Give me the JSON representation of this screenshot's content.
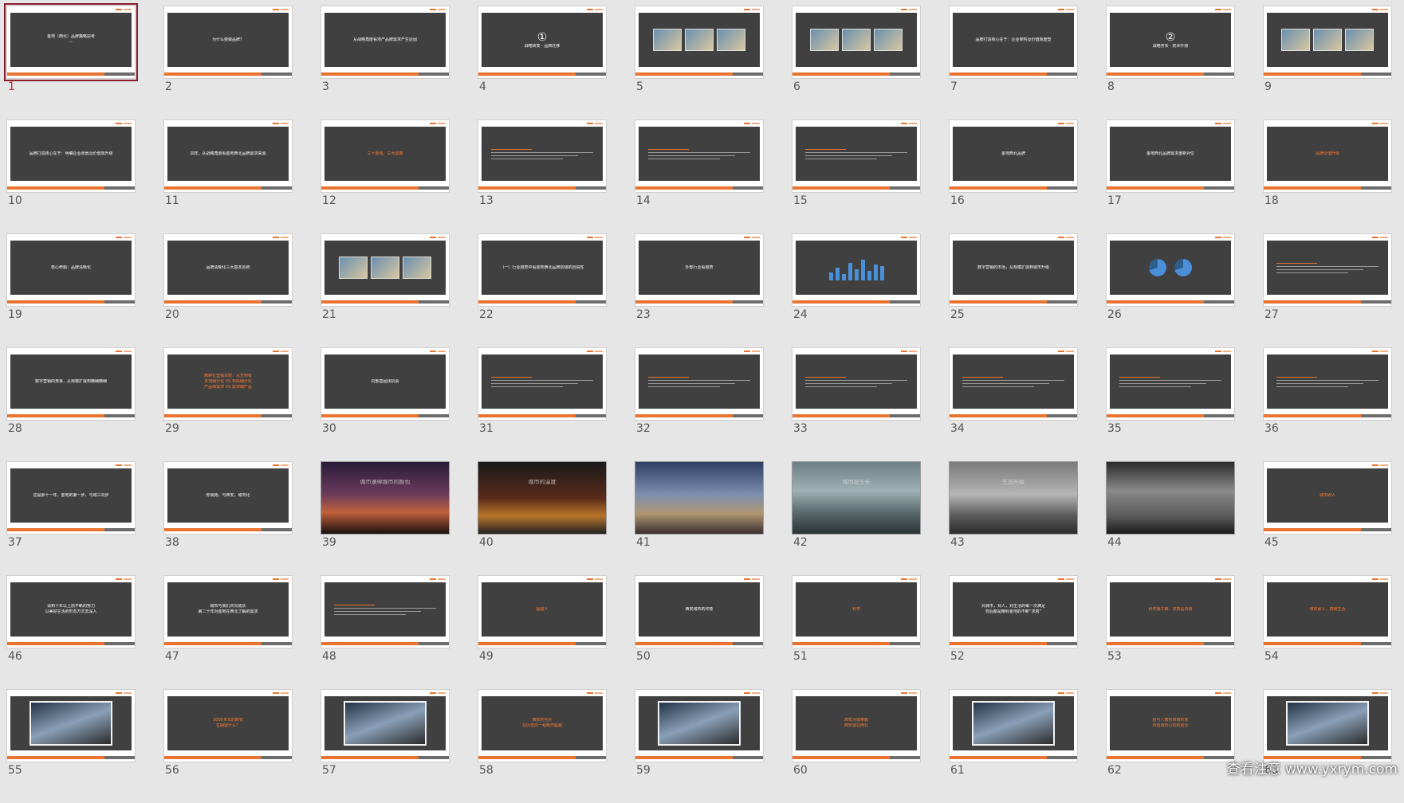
{
  "selected": 1,
  "watermark": "查看注意 www.yxrym.com",
  "slides": [
    {
      "n": "1",
      "kind": "title",
      "lines": [
        "金地（西北）品牌策略思考",
        "····"
      ]
    },
    {
      "n": "2",
      "kind": "text",
      "lines": [
        "为什么要做品牌？"
      ]
    },
    {
      "n": "3",
      "kind": "text",
      "lines": [
        "从战略角度看地产品牌需求产生原因"
      ]
    },
    {
      "n": "4",
      "kind": "circle",
      "circle": "①",
      "lines": [
        "战略转变 · 品牌迁移"
      ]
    },
    {
      "n": "5",
      "kind": "images",
      "lines": []
    },
    {
      "n": "6",
      "kind": "images",
      "lines": []
    },
    {
      "n": "7",
      "kind": "text",
      "lines": [
        "品牌打造核心在于：企业架构及价值观重塑"
      ]
    },
    {
      "n": "8",
      "kind": "circle",
      "circle": "②",
      "lines": [
        "战略务实 · 技术升级"
      ]
    },
    {
      "n": "9",
      "kind": "images",
      "lines": []
    },
    {
      "n": "10",
      "kind": "text",
      "lines": [
        "品牌打造核心在于：明确企业愿景及价值观升级"
      ]
    },
    {
      "n": "11",
      "kind": "text",
      "lines": [
        "同样，从战略角度看金地西北品牌需求来源"
      ]
    },
    {
      "n": "12",
      "kind": "orange",
      "lines": [
        "三十金城，三大需要"
      ]
    },
    {
      "n": "13",
      "kind": "lines",
      "lines": []
    },
    {
      "n": "14",
      "kind": "lines",
      "lines": []
    },
    {
      "n": "15",
      "kind": "lines",
      "lines": []
    },
    {
      "n": "16",
      "kind": "text",
      "lines": [
        "金地西北品牌"
      ]
    },
    {
      "n": "17",
      "kind": "text",
      "lines": [
        "金地西北品牌需求重新对位"
      ]
    },
    {
      "n": "18",
      "kind": "orange",
      "lines": [
        "品牌价值升级"
      ]
    },
    {
      "n": "19",
      "kind": "text",
      "lines": [
        "核心命题：品牌清晰化"
      ]
    },
    {
      "n": "20",
      "kind": "text",
      "lines": [
        "品牌清晰化三大基本原则"
      ]
    },
    {
      "n": "21",
      "kind": "images",
      "lines": []
    },
    {
      "n": "22",
      "kind": "text",
      "lines": [
        "（一）行业趋势中看金地西北品牌层级的自由性"
      ]
    },
    {
      "n": "23",
      "kind": "text",
      "lines": [
        "外部行业看趋势"
      ]
    },
    {
      "n": "24",
      "kind": "chart",
      "lines": []
    },
    {
      "n": "25",
      "kind": "text",
      "lines": [
        "数字营销的市场，从规模扩展到城市升级"
      ]
    },
    {
      "n": "26",
      "kind": "pies",
      "lines": []
    },
    {
      "n": "27",
      "kind": "lines",
      "lines": []
    },
    {
      "n": "28",
      "kind": "text",
      "lines": [
        "数字营销的竞争，从规模扩展到精细精细"
      ]
    },
    {
      "n": "29",
      "kind": "orange",
      "lines": [
        "精耕化营销本质：从无到有",
        "多地细分化 VS 布局细分化",
        "产品细需求 VS 需求细产品"
      ]
    },
    {
      "n": "30",
      "kind": "text",
      "lines": [
        "内部基因找机会"
      ]
    },
    {
      "n": "31",
      "kind": "lines",
      "lines": []
    },
    {
      "n": "32",
      "kind": "lines",
      "lines": []
    },
    {
      "n": "33",
      "kind": "lines",
      "lines": []
    },
    {
      "n": "34",
      "kind": "lines",
      "lines": []
    },
    {
      "n": "35",
      "kind": "lines",
      "lines": []
    },
    {
      "n": "36",
      "kind": "lines",
      "lines": []
    },
    {
      "n": "37",
      "kind": "text",
      "lines": [
        "这是那十一年，金地的第一步，与城三同步"
      ]
    },
    {
      "n": "38",
      "kind": "text",
      "lines": [
        "你我她，与西安，城市化"
      ]
    },
    {
      "n": "39",
      "kind": "photo",
      "style": "city1",
      "lines": [
        "城市速得城市的颜色"
      ]
    },
    {
      "n": "40",
      "kind": "photo",
      "style": "city2",
      "lines": [
        "城市的温度"
      ]
    },
    {
      "n": "41",
      "kind": "photo",
      "style": "city3",
      "lines": [
        ""
      ]
    },
    {
      "n": "42",
      "kind": "photo",
      "style": "city4",
      "lines": [
        "城市在生长"
      ]
    },
    {
      "n": "43",
      "kind": "photo",
      "style": "city5",
      "lines": [
        "生态升级"
      ]
    },
    {
      "n": "44",
      "kind": "photo",
      "style": "city6",
      "lines": [
        ""
      ]
    },
    {
      "n": "45",
      "kind": "orange",
      "lines": [
        "城市即人"
      ]
    },
    {
      "n": "46",
      "kind": "text",
      "lines": [
        "请到十年以上前不断的努力",
        "以美好生活的形态方式去深入"
      ]
    },
    {
      "n": "47",
      "kind": "text",
      "lines": [
        "城市与我们共同成长",
        "第二十年对金地在西北了解的需求"
      ]
    },
    {
      "n": "48",
      "kind": "lines",
      "lines": []
    },
    {
      "n": "49",
      "kind": "orange",
      "lines": [
        "超越人"
      ]
    },
    {
      "n": "50",
      "kind": "text",
      "lines": [
        "西安城市的印象"
      ]
    },
    {
      "n": "51",
      "kind": "orange",
      "lines": [
        "科学"
      ]
    },
    {
      "n": "52",
      "kind": "text",
      "lines": [
        "对城市，对人，对生活的每一次满足",
        "背后都是精科金地的不断“求真”"
      ]
    },
    {
      "n": "53",
      "kind": "orange",
      "lines": [
        "科学施工精，求真是内核"
      ]
    },
    {
      "n": "54",
      "kind": "orange",
      "lines": [
        "城市即人，真致生活"
      ]
    },
    {
      "n": "55",
      "kind": "framed",
      "lines": []
    },
    {
      "n": "56",
      "kind": "orange",
      "lines": [
        "3000多年的西安",
        "在期望什么？"
      ]
    },
    {
      "n": "57",
      "kind": "framed",
      "lines": []
    },
    {
      "n": "58",
      "kind": "orange",
      "lines": [
        "西安的名片",
        "在历史的一程略作超越"
      ]
    },
    {
      "n": "59",
      "kind": "framed",
      "lines": []
    },
    {
      "n": "60",
      "kind": "orange",
      "lines": [
        "西安为城奉献",
        "西安城在西北"
      ]
    },
    {
      "n": "61",
      "kind": "framed",
      "lines": []
    },
    {
      "n": "62",
      "kind": "orange",
      "lines": [
        "给与人着扮真西的家",
        "所有城市心的的成长"
      ]
    },
    {
      "n": "63",
      "kind": "framed",
      "lines": []
    }
  ]
}
